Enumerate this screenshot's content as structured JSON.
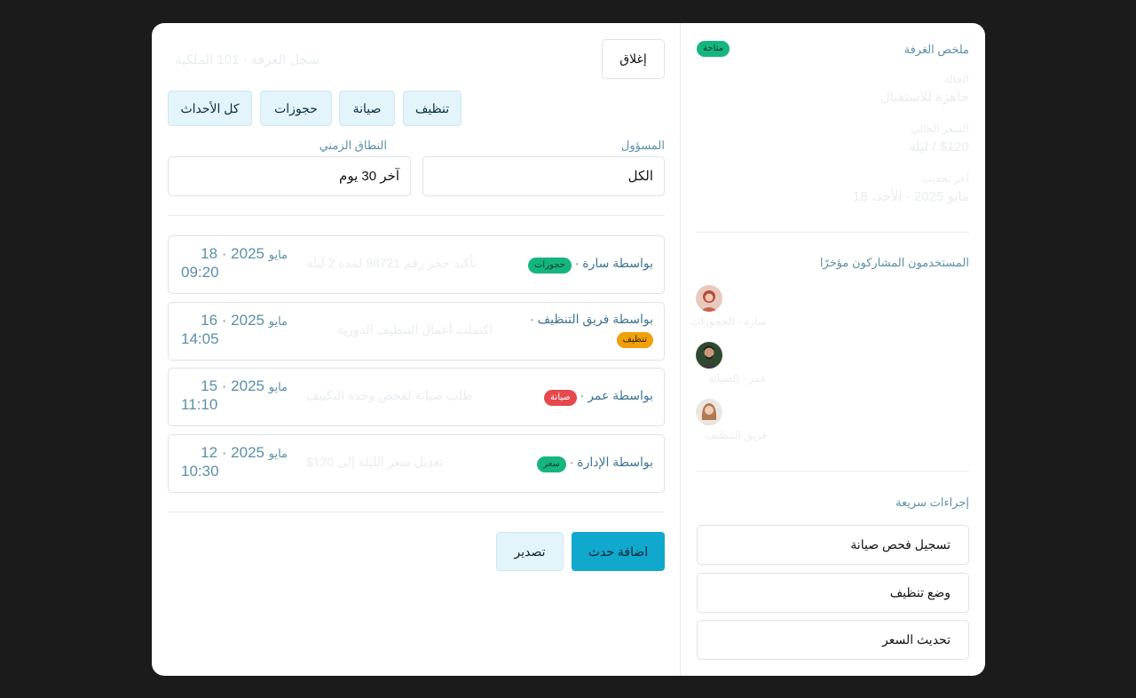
{
  "main": {
    "close_label": "إغلاق",
    "title": "سجل الغرفة · 101 الملكية",
    "tabs": [
      "كل الأحداث",
      "حجوزات",
      "صيانة",
      "تنظيف"
    ],
    "filters": {
      "owner_label": "المسؤول",
      "owner_value": "الكل",
      "range_label": "النطاق الزمني",
      "range_value": "آخر 30 يوم"
    },
    "events": [
      {
        "by": "بواسطة سارة ·",
        "badge": "حجوزات",
        "badge_color": "#16b57f",
        "desc": "تأكيد حجز رقم 98721 لمدة 2 ليلة",
        "month": "مايو",
        "year_day": "2025 · 18",
        "time": "09:20"
      },
      {
        "by": "بواسطة فريق التنظيف ·",
        "badge": "تنظيف",
        "badge_color": "#efa00a",
        "desc": "اكتملت أعمال التنظيف الدورية",
        "month": "مايو",
        "year_day": "2025 · 16",
        "time": "14:05"
      },
      {
        "by": "بواسطة عمر ·",
        "badge": "صيانة",
        "badge_color": "#e5484d",
        "desc": "طلب صيانة لفحص وحدة التكييف",
        "month": "مايو",
        "year_day": "2025 · 15",
        "time": "11:10"
      },
      {
        "by": "بواسطة الإدارة ·",
        "badge": "سعر",
        "badge_color": "#16b57f",
        "desc": "تعديل سعر الليلة إلى 120$",
        "month": "مايو",
        "year_day": "2025 · 12",
        "time": "10:30"
      }
    ],
    "add_event_label": "اضافة حدث",
    "export_label": "تصدير"
  },
  "sidebar": {
    "summary_title": "ملخص الغرفة",
    "status_badge": "متاحة",
    "fields": [
      {
        "label": "الحالة",
        "value": "جاهزة للاستقبال"
      },
      {
        "label": "السعر الحالي",
        "value": "$120 / ليلة"
      },
      {
        "label": "آخر تحديث",
        "value": "مايو 2025 · الأحد، 18"
      }
    ],
    "users_title": "المستخدمون المشاركون مؤخرًا",
    "users": [
      {
        "name": "سارة - الحجوزات"
      },
      {
        "name": "عمر - الصيانة"
      },
      {
        "name": "فريق التنظيف"
      }
    ],
    "quick_title": "إجراءات سريعة",
    "quick_actions": [
      "تسجيل فحص صيانة",
      "وضع تنظيف",
      "تحديث السعر"
    ]
  }
}
